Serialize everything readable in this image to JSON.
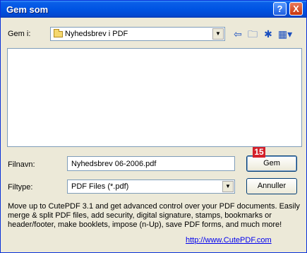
{
  "window": {
    "title": "Gem som"
  },
  "titlebar": {
    "help_label": "?",
    "close_label": "X"
  },
  "lookin": {
    "label": "Gem i:",
    "value": "Nyhedsbrev i PDF"
  },
  "toolbar": {
    "icons": [
      "back-arrow-icon",
      "up-folder-icon",
      "new-folder-icon",
      "views-menu-icon"
    ]
  },
  "form": {
    "filename_label": "Filnavn:",
    "filename_value": "Nyhedsbrev 06-2006.pdf",
    "filetype_label": "Filtype:",
    "filetype_value": "PDF Files (*.pdf)"
  },
  "buttons": {
    "save_label": "Gem",
    "cancel_label": "Annuller"
  },
  "badge": {
    "number": "15"
  },
  "promo": {
    "text": "Move up to CutePDF 3.1 and get advanced control over your PDF documents. Easily merge & split PDF files, add security, digital signature, stamps, bookmarks or header/footer, make booklets, impose (n-Up), save PDF forms, and much more!",
    "link": "http://www.CutePDF.com"
  },
  "colors": {
    "titlebar": "#0054e3",
    "dialog_bg": "#ece9d8",
    "badge": "#d4202a"
  }
}
